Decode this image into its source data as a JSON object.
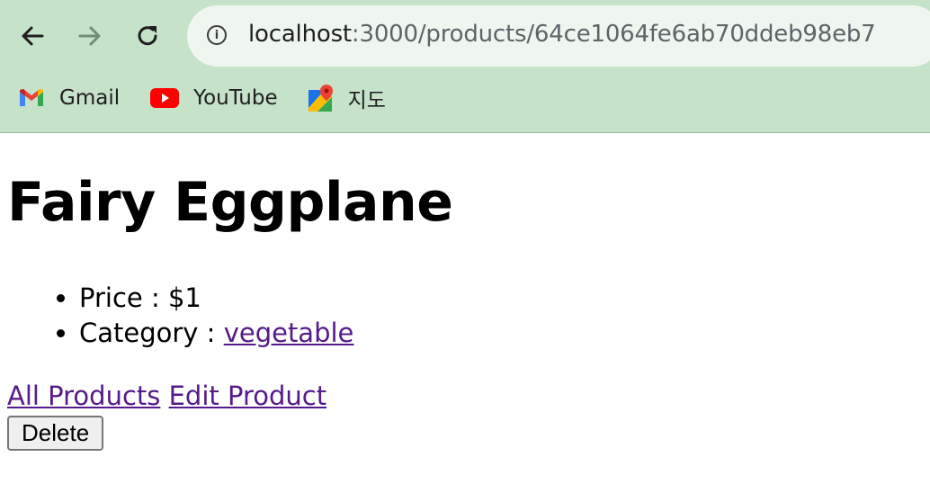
{
  "browser": {
    "back_icon": "←",
    "forward_icon": "→",
    "reload_icon": "↻",
    "url_host": "localhost",
    "url_rest": ":3000/products/64ce1064fe6ab70ddeb98eb7",
    "bookmarks": [
      {
        "label": "Gmail",
        "icon": "gmail-icon"
      },
      {
        "label": "YouTube",
        "icon": "youtube-icon"
      },
      {
        "label": "지도",
        "icon": "maps-icon"
      }
    ],
    "theme_color": "#c6e2c8"
  },
  "page": {
    "title": "Fairy Eggplane",
    "price_label": "Price : $1",
    "category_label": "Category : ",
    "category_link": "vegetable",
    "all_products_link": "All Products",
    "edit_product_link": "Edit Product",
    "delete_button": "Delete"
  }
}
